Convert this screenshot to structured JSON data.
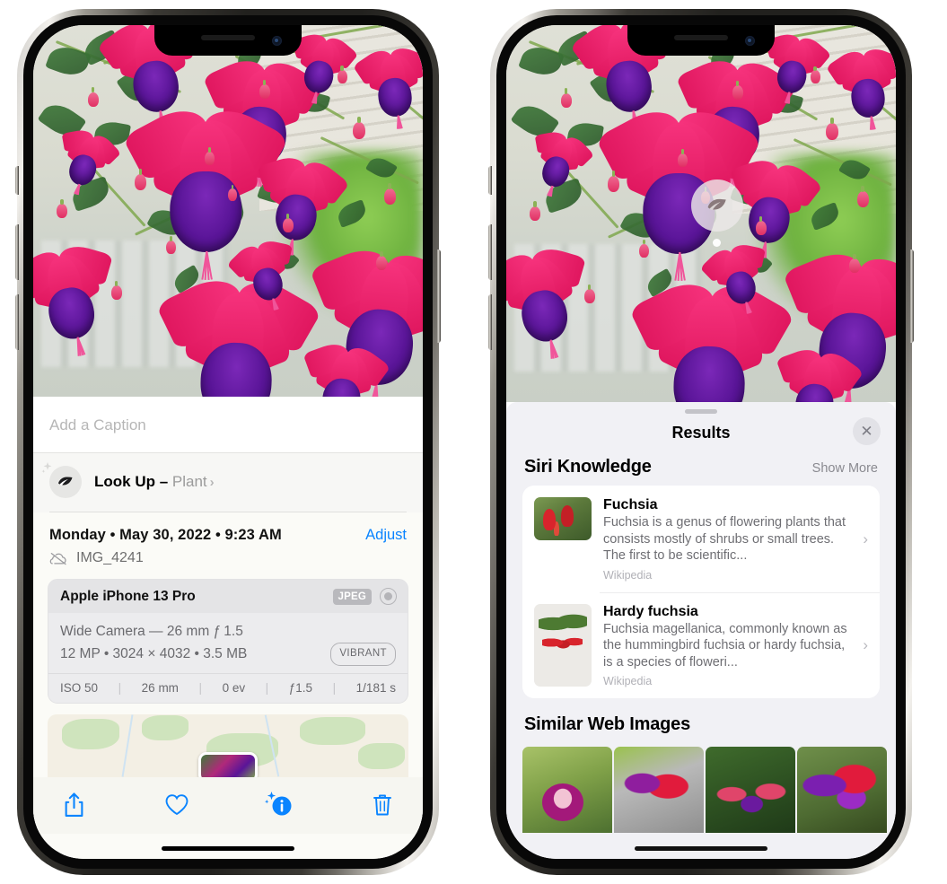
{
  "left_phone": {
    "caption": {
      "placeholder": "Add a Caption",
      "value": ""
    },
    "lookup": {
      "label": "Look Up –",
      "subject": "Plant",
      "chevron": "›",
      "icon": "leaf-icon",
      "sparkle_icon": "sparkle-icon"
    },
    "meta": {
      "date": "Monday • May 30, 2022 • 9:23 AM",
      "adjust_label": "Adjust",
      "filename": "IMG_4241",
      "cloud_icon": "cloud-slash-icon"
    },
    "exif": {
      "device": "Apple iPhone 13 Pro",
      "format_badge": "JPEG",
      "lens_icon": "lens-icon",
      "lens_line": "Wide Camera — 26 mm ƒ 1.5",
      "size_line": "12 MP • 3024 × 4032 • 3.5 MB",
      "style_badge": "VIBRANT",
      "stats": [
        "ISO 50",
        "26 mm",
        "0 ev",
        "ƒ1.5",
        "1/181 s"
      ],
      "separator": "|"
    },
    "toolbar": [
      {
        "name": "share-button",
        "icon": "share-icon"
      },
      {
        "name": "favorite-button",
        "icon": "heart-icon"
      },
      {
        "name": "info-button",
        "icon": "info-sparkle-icon"
      },
      {
        "name": "delete-button",
        "icon": "trash-icon"
      }
    ],
    "map": {
      "pin_label": "photo-pin"
    }
  },
  "right_phone": {
    "photo_badge": {
      "icon": "leaf-icon"
    },
    "panel": {
      "grabber": "drag-handle",
      "title": "Results",
      "close_label": "✕"
    },
    "siri_knowledge": {
      "heading": "Siri Knowledge",
      "show_more": "Show More",
      "items": [
        {
          "title": "Fuchsia",
          "description": "Fuchsia is a genus of flowering plants that consists mostly of shrubs or small trees. The first to be scientific...",
          "source": "Wikipedia",
          "chevron": "›"
        },
        {
          "title": "Hardy fuchsia",
          "description": "Fuchsia magellanica, commonly known as the hummingbird fuchsia or hardy fuchsia, is a species of floweri...",
          "source": "Wikipedia",
          "chevron": "›"
        }
      ]
    },
    "similar_web_images": {
      "heading": "Similar Web Images",
      "thumbs": [
        "web-image-1",
        "web-image-2",
        "web-image-3",
        "web-image-4"
      ]
    }
  },
  "colors": {
    "accent_blue": "#0a84ff",
    "panel_bg": "#f1f1f5",
    "sheet_bg": "#fbfbf7",
    "exif_bg": "#ececee",
    "muted_text": "#6e6e73"
  }
}
